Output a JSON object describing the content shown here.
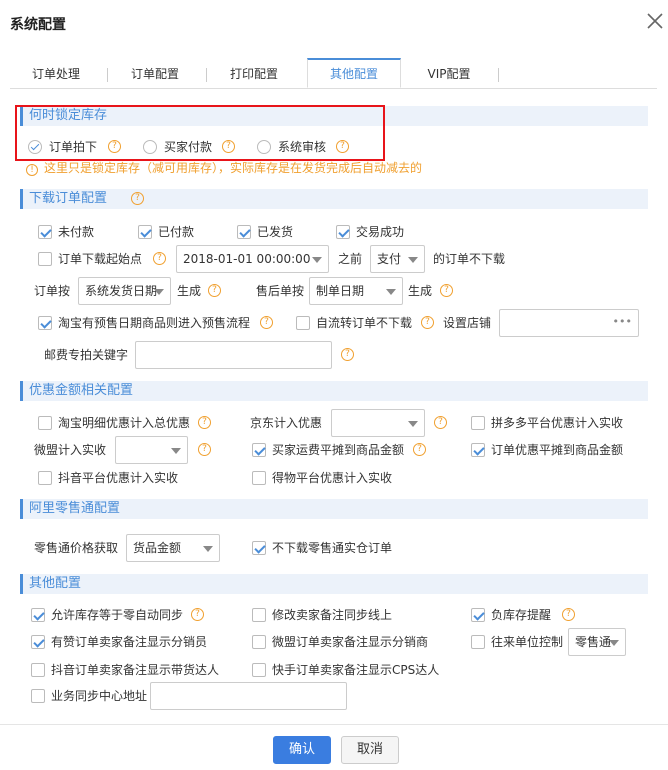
{
  "dialog": {
    "title": "系统配置",
    "ok": "确认",
    "cancel": "取消"
  },
  "tabs": [
    "订单处理",
    "订单配置",
    "打印配置",
    "其他配置",
    "VIP配置"
  ],
  "lock": {
    "title": "何时锁定库存",
    "options": [
      "订单拍下",
      "买家付款",
      "系统审核"
    ],
    "selected": 0,
    "warning": "这里只是锁定库存（减可用库存），实际库存是在发货完成后自动减去的"
  },
  "download": {
    "title": "下载订单配置",
    "status": [
      {
        "label": "未付款",
        "checked": true
      },
      {
        "label": "已付款",
        "checked": true
      },
      {
        "label": "已发货",
        "checked": true
      },
      {
        "label": "交易成功",
        "checked": true
      }
    ],
    "start_label": "订单下载起始点",
    "start_date": "2018-01-01 00:00:00",
    "before": "之前",
    "pay_select": "支付",
    "not_download": "的订单不下载",
    "order_by": "订单按",
    "order_by_select": "系统发货日期",
    "generate1": "生成",
    "after_sale_by": "售后单按",
    "after_sale_select": "制单日期",
    "generate2": "生成",
    "presale": "淘宝有预售日期商品则进入预售流程",
    "self_flow": "自流转订单不下载",
    "shop_setting": "设置店铺",
    "postage_kw": "邮费专拍关键字"
  },
  "discount": {
    "title": "优惠金额相关配置",
    "taobao": "淘宝明细优惠计入总优惠",
    "jd": "京东计入优惠",
    "pdd": "拼多多平台优惠计入实收",
    "weidian": "微盟计入实收",
    "buyer_freight": "买家运费平摊到商品金额",
    "order_discount": "订单优惠平摊到商品金额",
    "douyin": "抖音平台优惠计入实收",
    "dewu": "得物平台优惠计入实收"
  },
  "ali": {
    "title": "阿里零售通配置",
    "price_label": "零售通价格获取",
    "price_select": "货品金额",
    "no_merge": "不下载零售通实仓订单"
  },
  "other": {
    "title": "其他配置",
    "allow_zero": "允许库存等于零自动同步",
    "modify_remark": "修改卖家备注同步线上",
    "neg_stock": "负库存提醒",
    "youzan": "有赞订单卖家备注显示分销员",
    "weimeng": "微盟订单卖家备注显示分销商",
    "unit_ctrl": "往来单位控制",
    "unit_select": "零售通",
    "douyin_remark": "抖音订单卖家备注显示带货达人",
    "kuaishou": "快手订单卖家备注显示CPS达人",
    "sync_center": "业务同步中心地址"
  },
  "colors": {
    "accent": "#4a8dd8",
    "warn": "#f0a030",
    "highlight": "#e8141a"
  }
}
